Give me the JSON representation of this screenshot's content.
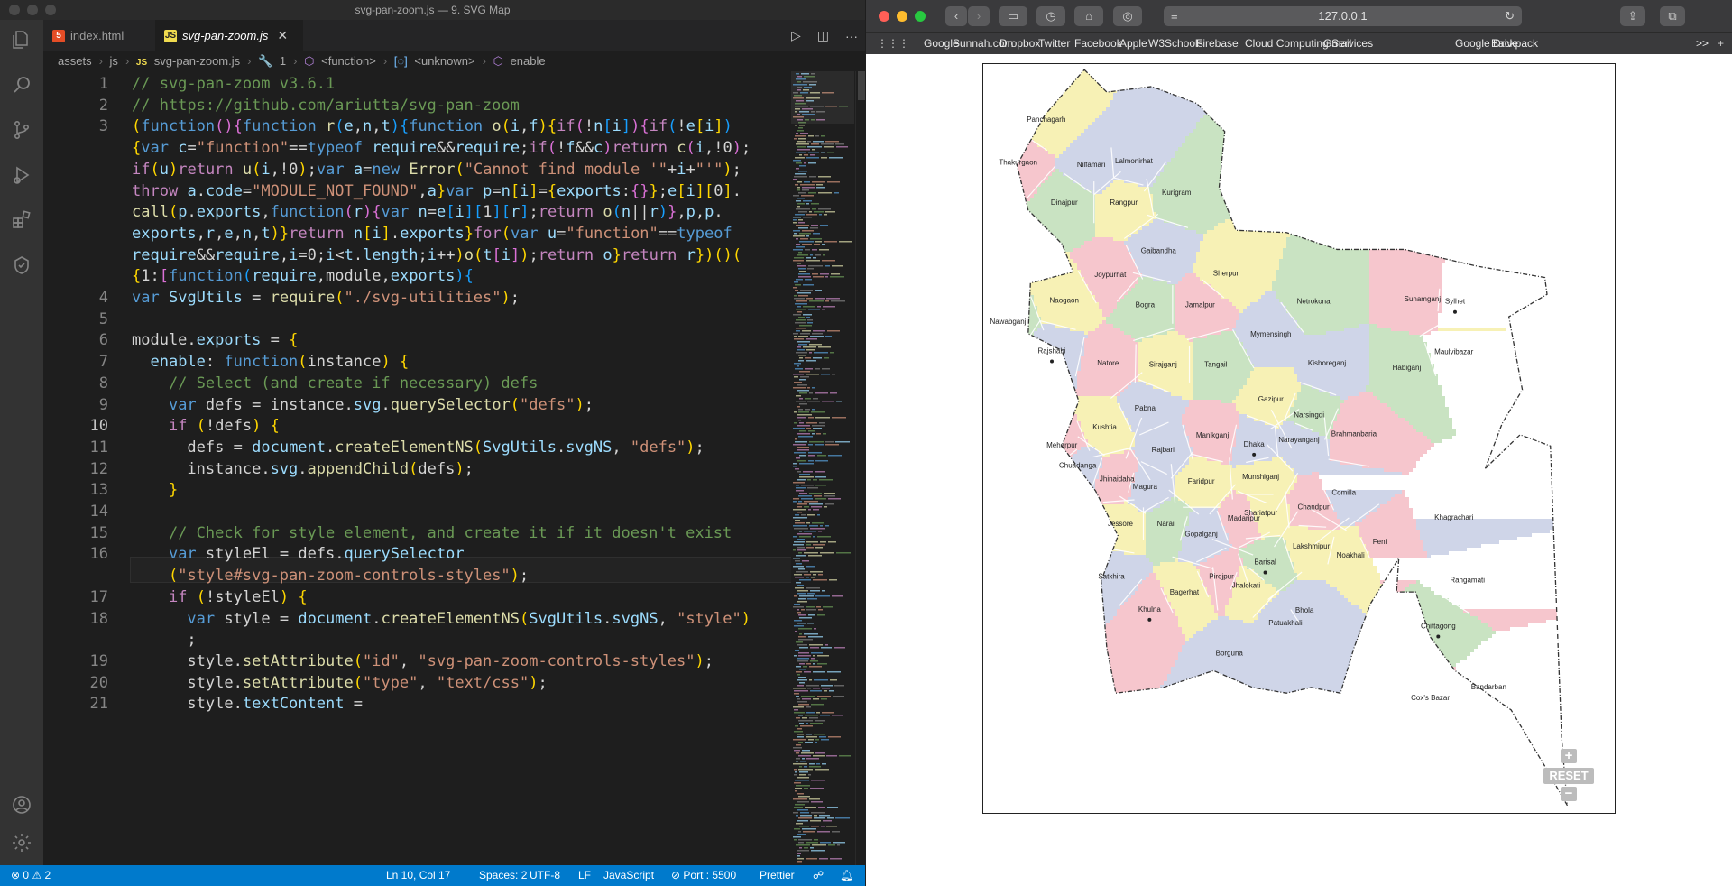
{
  "vscode": {
    "window_title": "svg-pan-zoom.js — 9. SVG Map",
    "tabs": [
      {
        "label": "index.html",
        "icon": "html-file-icon"
      },
      {
        "label": "svg-pan-zoom.js",
        "icon": "js-file-icon",
        "active": true
      }
    ],
    "breadcrumb": [
      "assets",
      "js",
      "svg-pan-zoom.js",
      "1",
      "<function>",
      "<unknown>",
      "enable"
    ],
    "current_line": 10,
    "lines": [
      {
        "n": "1",
        "text": "// svg-pan-zoom v3.6.1"
      },
      {
        "n": "2",
        "text": "// https://github.com/ariutta/svg-pan-zoom"
      },
      {
        "n": "3",
        "text": "(function(){function r(e,n,t){function o(i,f){if(!n[i]){if(!e[i])"
      },
      {
        "n": "",
        "text": "{var c=\"function\"==typeof require&&require;if(!f&&c)return c(i,!0);"
      },
      {
        "n": "",
        "text": "if(u)return u(i,!0);var a=new Error(\"Cannot find module '\"+i+\"'\");"
      },
      {
        "n": "",
        "text": "throw a.code=\"MODULE_NOT_FOUND\",a}var p=n[i]={exports:{}};e[i][0]."
      },
      {
        "n": "",
        "text": "call(p.exports,function(r){var n=e[i][1][r];return o(n||r)},p,p."
      },
      {
        "n": "",
        "text": "exports,r,e,n,t)}return n[i].exports}for(var u=\"function\"==typeof"
      },
      {
        "n": "",
        "text": "require&&require,i=0;i<t.length;i++)o(t[i]);return o}return r})()("
      },
      {
        "n": "",
        "text": "{1:[function(require,module,exports){"
      },
      {
        "n": "4",
        "text": "var SvgUtils = require(\"./svg-utilities\");"
      },
      {
        "n": "5",
        "text": ""
      },
      {
        "n": "6",
        "text": "module.exports = {"
      },
      {
        "n": "7",
        "text": "  enable: function(instance) {"
      },
      {
        "n": "8",
        "text": "    // Select (and create if necessary) defs"
      },
      {
        "n": "9",
        "text": "    var defs = instance.svg.querySelector(\"defs\");"
      },
      {
        "n": "10",
        "text": "    if (!defs) {"
      },
      {
        "n": "11",
        "text": "      defs = document.createElementNS(SvgUtils.svgNS, \"defs\");"
      },
      {
        "n": "12",
        "text": "      instance.svg.appendChild(defs);"
      },
      {
        "n": "13",
        "text": "    }"
      },
      {
        "n": "14",
        "text": ""
      },
      {
        "n": "15",
        "text": "    // Check for style element, and create it if it doesn't exist"
      },
      {
        "n": "16",
        "text": "    var styleEl = defs.querySelector"
      },
      {
        "n": "",
        "text": "    (\"style#svg-pan-zoom-controls-styles\");"
      },
      {
        "n": "17",
        "text": "    if (!styleEl) {"
      },
      {
        "n": "18",
        "text": "      var style = document.createElementNS(SvgUtils.svgNS, \"style\")"
      },
      {
        "n": "",
        "text": "      ;"
      },
      {
        "n": "19",
        "text": "      style.setAttribute(\"id\", \"svg-pan-zoom-controls-styles\");"
      },
      {
        "n": "20",
        "text": "      style.setAttribute(\"type\", \"text/css\");"
      },
      {
        "n": "21",
        "text": "      style.textContent ="
      }
    ],
    "status": {
      "errors": "0",
      "warnings": "2",
      "position": "Ln 10, Col 17",
      "spaces": "Spaces: 2",
      "encoding": "UTF-8",
      "eol": "LF",
      "language": "JavaScript",
      "port": "Port : 5500",
      "formatter": "Prettier"
    }
  },
  "safari": {
    "url": "127.0.0.1",
    "bookmarks": [
      "Google",
      "Sunnah.com",
      "Dropbox",
      "Twitter",
      "Facebook",
      "Apple",
      "W3Schools",
      "Firebase",
      "Cloud Computing Services",
      "Gmail",
      "Google Drive",
      "Backpack"
    ],
    "bookmarks_overflow": ">>"
  },
  "map": {
    "districts": [
      "Panchagarh",
      "Thakurgaon",
      "Nilfamari",
      "Lalmonirhat",
      "Dinajpur",
      "Rangpur",
      "Kurigram",
      "Gaibandha",
      "Joypurhat",
      "Naogaon",
      "Bogra",
      "Jamalpur",
      "Sherpur",
      "Netrokona",
      "Sunamganj",
      "Sylhet",
      "Nawabganj",
      "Rajshahi",
      "Natore",
      "Sirajganj",
      "Tangail",
      "Mymensingh",
      "Kishoreganj",
      "Habiganj",
      "Maulvibazar",
      "Pabna",
      "Gazipur",
      "Narsingdi",
      "Kushtia",
      "Manikganj",
      "Dhaka",
      "Narayanganj",
      "Brahmanbaria",
      "Meherpur",
      "Rajbari",
      "Chuadanga",
      "Jhinaidaha",
      "Magura",
      "Faridpur",
      "Munshiganj",
      "Comilla",
      "Khagrachari",
      "Chandpur",
      "Jessore",
      "Narail",
      "Madaripur",
      "Shariatpur",
      "Gopalganj",
      "Lakshmipur",
      "Noakhali",
      "Feni",
      "Barisal",
      "Satkhira",
      "Pirojpur",
      "Jhalokati",
      "Rangamati",
      "Bagerhat",
      "Khulna",
      "Bhola",
      "Patuakhali",
      "Chittagong",
      "Borguna",
      "Bandarban",
      "Cox's Bazar"
    ],
    "controls": {
      "zoom_in": "+",
      "reset": "RESET",
      "zoom_out": "−"
    },
    "colors": {
      "yellow": "#f7f1b5",
      "green": "#c9e3c2",
      "pink": "#f6c6cd",
      "blue": "#cfd5e8"
    }
  }
}
